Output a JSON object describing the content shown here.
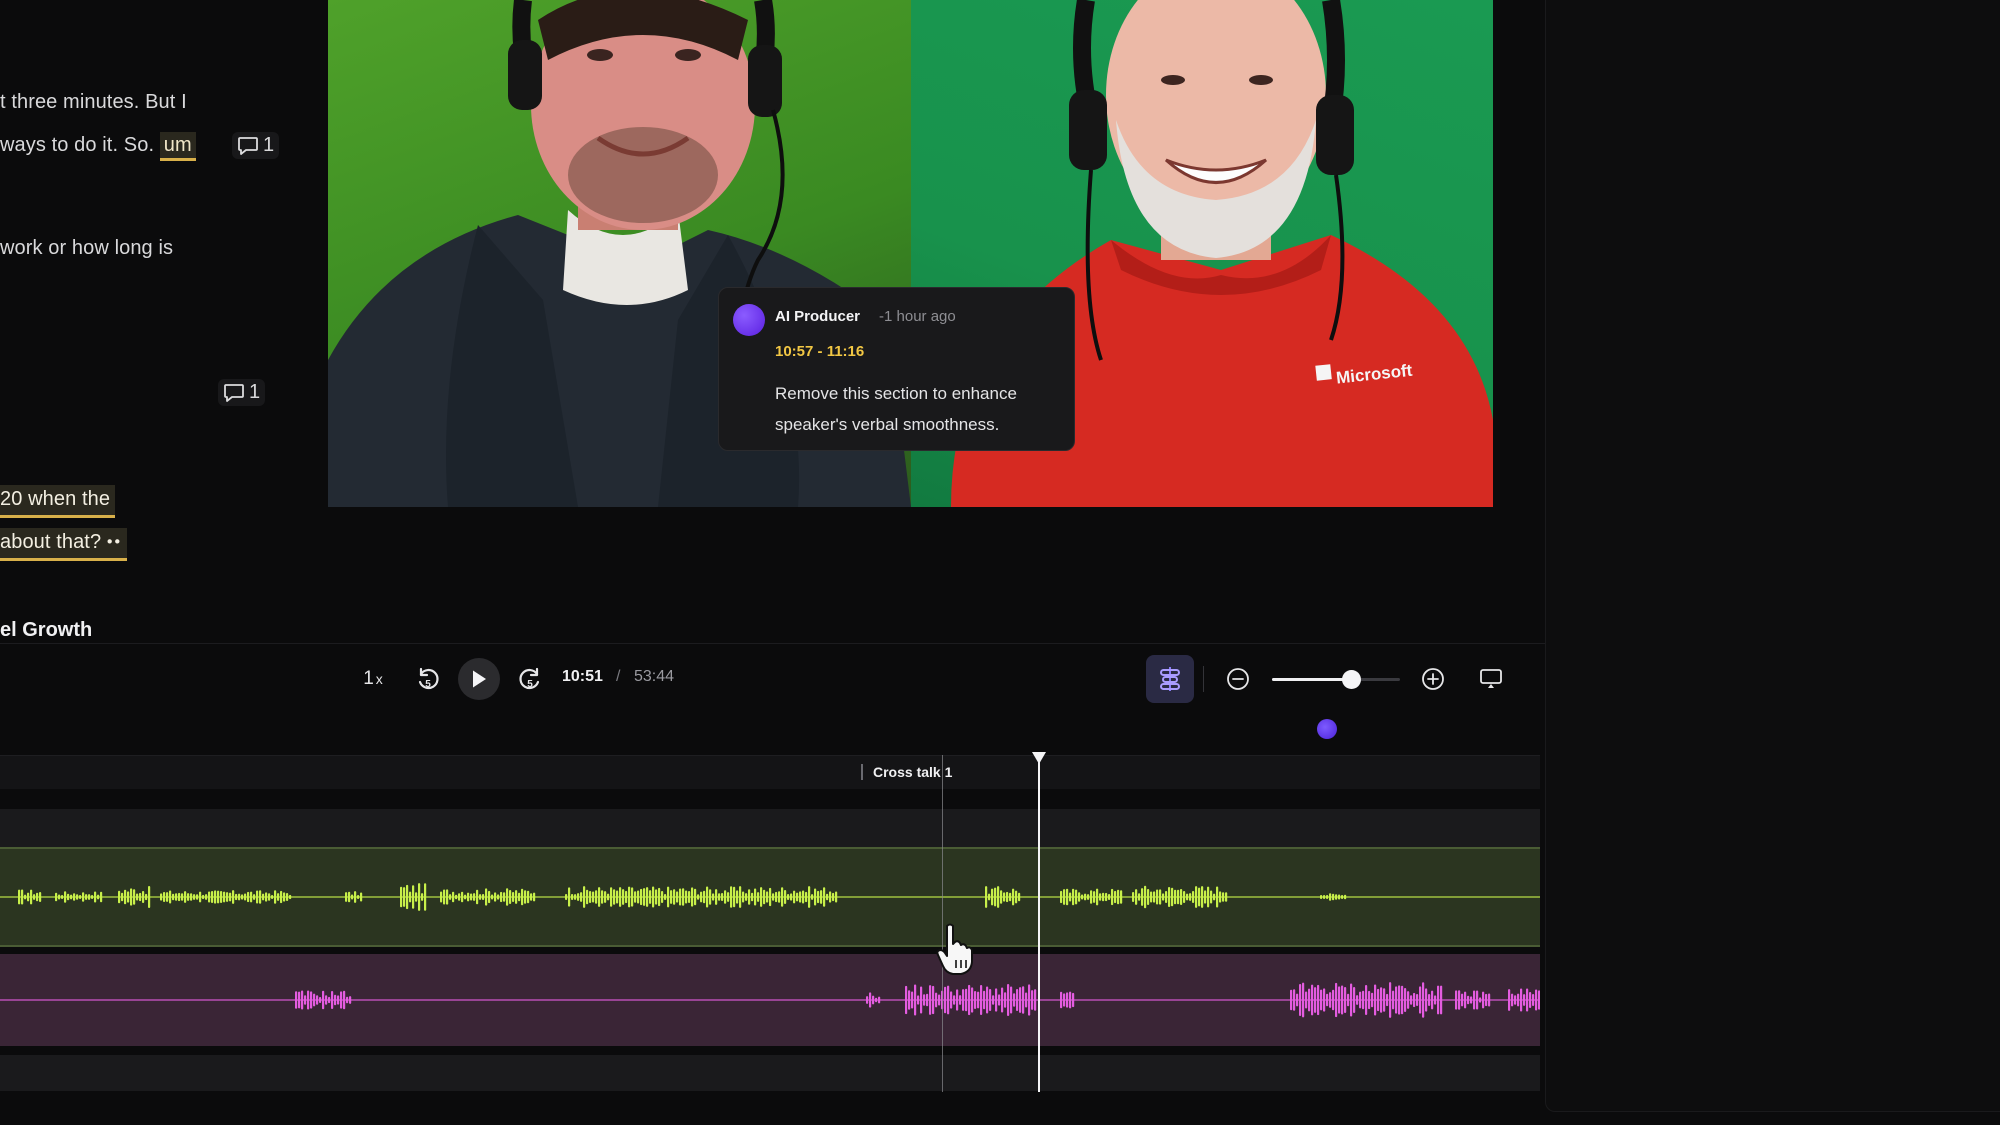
{
  "transcript": {
    "lines": [
      {
        "text": "t three minutes. But I"
      },
      {
        "text": "ways to do it. So.",
        "filler": "um"
      },
      {
        "text": "work or how long is"
      },
      {
        "text": "20 when the"
      },
      {
        "text": "about that?",
        "dots": "••"
      }
    ],
    "comment_badges": [
      {
        "count": "1"
      },
      {
        "count": "1"
      }
    ],
    "section_title": "el Growth"
  },
  "comment_popup": {
    "author": "AI Producer",
    "time_ago": "-1 hour ago",
    "range": "10:57 - 11:16",
    "text": "Remove this section to enhance speaker's verbal smoothness.",
    "avatar_color": "#6b3cf5"
  },
  "video": {
    "shirt_brand": "Microsoft"
  },
  "player": {
    "speed": "1",
    "speed_suffix": "x",
    "skip_back_label": "5",
    "skip_forward_label": "5",
    "current_time": "10:51",
    "separator": "/",
    "total_time": "53:44",
    "zoom_level": 0.62
  },
  "timeline": {
    "marker_label": "Cross talk 1",
    "add_label": "+",
    "track_colors": {
      "speaker_a": "#c8f04a",
      "speaker_b": "#e45ce0"
    }
  },
  "colors": {
    "accent": "#6b3cf5",
    "highlight": "#d8b04a",
    "time_range": "#f2c744"
  }
}
